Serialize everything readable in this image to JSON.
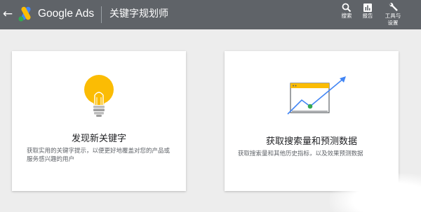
{
  "header": {
    "back_icon": "arrow-back-icon",
    "brand": "Google Ads",
    "page_title": "关键字规划师",
    "tools": [
      {
        "label": "搜索",
        "icon": "search-icon"
      },
      {
        "label": "报告",
        "icon": "report-icon"
      },
      {
        "label": "工具与\n设置",
        "icon": "wrench-icon"
      }
    ]
  },
  "cards": [
    {
      "title": "发现新关键字",
      "description": "获取实用的关键字提示，以便更好地覆盖对您的产品或服务感兴趣的用户",
      "icon": "lightbulb-icon"
    },
    {
      "title": "获取搜索量和预测数据",
      "description": "获取搜索量和其他历史指标，以及效果预测数据",
      "icon": "trend-chart-icon"
    }
  ],
  "colors": {
    "header_bg": "#5f6368",
    "page_bg": "#ededed",
    "bulb_yellow": "#fbbc04",
    "trend_blue": "#4285f4",
    "point_green": "#34a853"
  }
}
